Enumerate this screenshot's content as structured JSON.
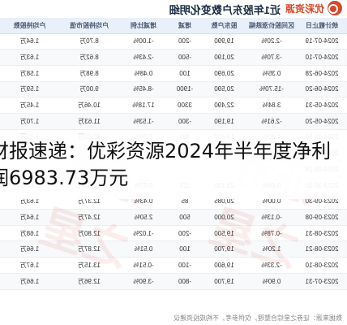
{
  "header": {
    "brand": "优彩资源",
    "title": "近1年股东户数变化明细"
  },
  "table": {
    "columns": [
      "统计截止日",
      "区间股价涨跌幅",
      "股东户数",
      "增减",
      "增减比例",
      "户均持股市值",
      "户均持股数"
    ],
    "rows": [
      [
        "2024-07-19",
        "-2.20%",
        "19,990",
        "-200",
        "-1.00%",
        "8.70万",
        "1.64万"
      ],
      [
        "2024-07-10",
        "-3.70%",
        "20,190",
        "-500",
        "-2.43%",
        "8.62万",
        "1.63万"
      ],
      [
        "2024-06-28",
        "0.35%",
        "20,690",
        "100",
        "0.48%",
        "8.98万",
        "1.58万"
      ],
      [
        "2024-06-20",
        "-15.70%",
        "20,590",
        "-1900",
        "-8.45%",
        "9.00万",
        "1.59万"
      ],
      [
        "2024-05-31",
        "3.84%",
        "22,490",
        "3300",
        "17.18%",
        "10.46万",
        "1.45万"
      ],
      [
        "2024-05-20",
        "-2.61%",
        "19,190",
        "-300",
        "-1.53%",
        "11.63万",
        "1.70万"
      ],
      [
        "2024-05-10",
        "4.20%",
        "19,490",
        "400",
        "2.09%",
        "12.00万",
        "1.72万"
      ],
      [
        "2024-04-19",
        "",
        "",
        "",
        "",
        "",
        ""
      ],
      [
        "2024-03-29",
        "",
        "",
        "",
        "",
        "",
        ""
      ],
      [
        "2023-10-10",
        "0.66%",
        "23,100",
        "115",
        "0.57%",
        "12.41万",
        "1.63万"
      ],
      [
        "2023-09-30",
        "0.00%",
        "20,085",
        "85",
        "0.43%",
        "12.37万",
        "1.63万"
      ],
      [
        "2023-09-08",
        "-0.13%",
        "20,000",
        "500",
        "2.50%",
        "12.47万",
        "1.64万"
      ],
      [
        "2023-08-31",
        "-0.78%",
        "19,500",
        "-200",
        "-1.02%",
        "12.80万",
        "1.68万"
      ],
      [
        "2023-08-21",
        "1.20%",
        "19,700",
        "100",
        "0.51%",
        "12.87万",
        "1.66万"
      ],
      [
        "2023-08-10",
        "-2.33%",
        "19,600",
        "-100",
        "-0.51%",
        "13.15万",
        "1.67万"
      ],
      [
        "2023-07-31",
        "0.90%",
        "19,700",
        "-800",
        "-3.90%",
        "12.96万",
        "1.66万"
      ]
    ]
  },
  "footer": {
    "text": "数据来源：证券之星综合整理，仅供参考，不构成投资建议"
  },
  "watermarks": [
    "证券之星",
    "证券之星"
  ],
  "headline": {
    "line1": "财报速递：优彩资源2024年半年度净利",
    "line2": "润6983.73万元"
  }
}
